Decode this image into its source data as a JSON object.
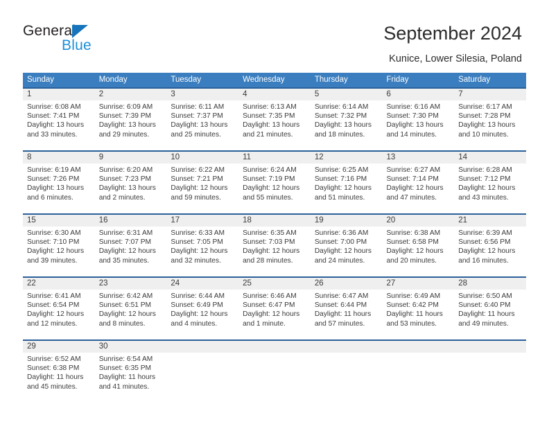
{
  "brand": {
    "word_one": "General",
    "word_two": "Blue",
    "triangle_color": "#1574bb",
    "blue_text_color": "#1a8fd8"
  },
  "header": {
    "title": "September 2024",
    "subtitle": "Kunice, Lower Silesia, Poland"
  },
  "colors": {
    "header_blue": "#3b7ebf",
    "row_divider": "#2a6099",
    "day_number_bar": "#efefef",
    "text": "#3a3a3a"
  },
  "weekdays": [
    "Sunday",
    "Monday",
    "Tuesday",
    "Wednesday",
    "Thursday",
    "Friday",
    "Saturday"
  ],
  "weeks": [
    [
      {
        "day": "1",
        "sunrise": "Sunrise: 6:08 AM",
        "sunset": "Sunset: 7:41 PM",
        "daylight_1": "Daylight: 13 hours",
        "daylight_2": "and 33 minutes."
      },
      {
        "day": "2",
        "sunrise": "Sunrise: 6:09 AM",
        "sunset": "Sunset: 7:39 PM",
        "daylight_1": "Daylight: 13 hours",
        "daylight_2": "and 29 minutes."
      },
      {
        "day": "3",
        "sunrise": "Sunrise: 6:11 AM",
        "sunset": "Sunset: 7:37 PM",
        "daylight_1": "Daylight: 13 hours",
        "daylight_2": "and 25 minutes."
      },
      {
        "day": "4",
        "sunrise": "Sunrise: 6:13 AM",
        "sunset": "Sunset: 7:35 PM",
        "daylight_1": "Daylight: 13 hours",
        "daylight_2": "and 21 minutes."
      },
      {
        "day": "5",
        "sunrise": "Sunrise: 6:14 AM",
        "sunset": "Sunset: 7:32 PM",
        "daylight_1": "Daylight: 13 hours",
        "daylight_2": "and 18 minutes."
      },
      {
        "day": "6",
        "sunrise": "Sunrise: 6:16 AM",
        "sunset": "Sunset: 7:30 PM",
        "daylight_1": "Daylight: 13 hours",
        "daylight_2": "and 14 minutes."
      },
      {
        "day": "7",
        "sunrise": "Sunrise: 6:17 AM",
        "sunset": "Sunset: 7:28 PM",
        "daylight_1": "Daylight: 13 hours",
        "daylight_2": "and 10 minutes."
      }
    ],
    [
      {
        "day": "8",
        "sunrise": "Sunrise: 6:19 AM",
        "sunset": "Sunset: 7:26 PM",
        "daylight_1": "Daylight: 13 hours",
        "daylight_2": "and 6 minutes."
      },
      {
        "day": "9",
        "sunrise": "Sunrise: 6:20 AM",
        "sunset": "Sunset: 7:23 PM",
        "daylight_1": "Daylight: 13 hours",
        "daylight_2": "and 2 minutes."
      },
      {
        "day": "10",
        "sunrise": "Sunrise: 6:22 AM",
        "sunset": "Sunset: 7:21 PM",
        "daylight_1": "Daylight: 12 hours",
        "daylight_2": "and 59 minutes."
      },
      {
        "day": "11",
        "sunrise": "Sunrise: 6:24 AM",
        "sunset": "Sunset: 7:19 PM",
        "daylight_1": "Daylight: 12 hours",
        "daylight_2": "and 55 minutes."
      },
      {
        "day": "12",
        "sunrise": "Sunrise: 6:25 AM",
        "sunset": "Sunset: 7:16 PM",
        "daylight_1": "Daylight: 12 hours",
        "daylight_2": "and 51 minutes."
      },
      {
        "day": "13",
        "sunrise": "Sunrise: 6:27 AM",
        "sunset": "Sunset: 7:14 PM",
        "daylight_1": "Daylight: 12 hours",
        "daylight_2": "and 47 minutes."
      },
      {
        "day": "14",
        "sunrise": "Sunrise: 6:28 AM",
        "sunset": "Sunset: 7:12 PM",
        "daylight_1": "Daylight: 12 hours",
        "daylight_2": "and 43 minutes."
      }
    ],
    [
      {
        "day": "15",
        "sunrise": "Sunrise: 6:30 AM",
        "sunset": "Sunset: 7:10 PM",
        "daylight_1": "Daylight: 12 hours",
        "daylight_2": "and 39 minutes."
      },
      {
        "day": "16",
        "sunrise": "Sunrise: 6:31 AM",
        "sunset": "Sunset: 7:07 PM",
        "daylight_1": "Daylight: 12 hours",
        "daylight_2": "and 35 minutes."
      },
      {
        "day": "17",
        "sunrise": "Sunrise: 6:33 AM",
        "sunset": "Sunset: 7:05 PM",
        "daylight_1": "Daylight: 12 hours",
        "daylight_2": "and 32 minutes."
      },
      {
        "day": "18",
        "sunrise": "Sunrise: 6:35 AM",
        "sunset": "Sunset: 7:03 PM",
        "daylight_1": "Daylight: 12 hours",
        "daylight_2": "and 28 minutes."
      },
      {
        "day": "19",
        "sunrise": "Sunrise: 6:36 AM",
        "sunset": "Sunset: 7:00 PM",
        "daylight_1": "Daylight: 12 hours",
        "daylight_2": "and 24 minutes."
      },
      {
        "day": "20",
        "sunrise": "Sunrise: 6:38 AM",
        "sunset": "Sunset: 6:58 PM",
        "daylight_1": "Daylight: 12 hours",
        "daylight_2": "and 20 minutes."
      },
      {
        "day": "21",
        "sunrise": "Sunrise: 6:39 AM",
        "sunset": "Sunset: 6:56 PM",
        "daylight_1": "Daylight: 12 hours",
        "daylight_2": "and 16 minutes."
      }
    ],
    [
      {
        "day": "22",
        "sunrise": "Sunrise: 6:41 AM",
        "sunset": "Sunset: 6:54 PM",
        "daylight_1": "Daylight: 12 hours",
        "daylight_2": "and 12 minutes."
      },
      {
        "day": "23",
        "sunrise": "Sunrise: 6:42 AM",
        "sunset": "Sunset: 6:51 PM",
        "daylight_1": "Daylight: 12 hours",
        "daylight_2": "and 8 minutes."
      },
      {
        "day": "24",
        "sunrise": "Sunrise: 6:44 AM",
        "sunset": "Sunset: 6:49 PM",
        "daylight_1": "Daylight: 12 hours",
        "daylight_2": "and 4 minutes."
      },
      {
        "day": "25",
        "sunrise": "Sunrise: 6:46 AM",
        "sunset": "Sunset: 6:47 PM",
        "daylight_1": "Daylight: 12 hours",
        "daylight_2": "and 1 minute."
      },
      {
        "day": "26",
        "sunrise": "Sunrise: 6:47 AM",
        "sunset": "Sunset: 6:44 PM",
        "daylight_1": "Daylight: 11 hours",
        "daylight_2": "and 57 minutes."
      },
      {
        "day": "27",
        "sunrise": "Sunrise: 6:49 AM",
        "sunset": "Sunset: 6:42 PM",
        "daylight_1": "Daylight: 11 hours",
        "daylight_2": "and 53 minutes."
      },
      {
        "day": "28",
        "sunrise": "Sunrise: 6:50 AM",
        "sunset": "Sunset: 6:40 PM",
        "daylight_1": "Daylight: 11 hours",
        "daylight_2": "and 49 minutes."
      }
    ],
    [
      {
        "day": "29",
        "sunrise": "Sunrise: 6:52 AM",
        "sunset": "Sunset: 6:38 PM",
        "daylight_1": "Daylight: 11 hours",
        "daylight_2": "and 45 minutes."
      },
      {
        "day": "30",
        "sunrise": "Sunrise: 6:54 AM",
        "sunset": "Sunset: 6:35 PM",
        "daylight_1": "Daylight: 11 hours",
        "daylight_2": "and 41 minutes."
      },
      {
        "day": "",
        "sunrise": "",
        "sunset": "",
        "daylight_1": "",
        "daylight_2": ""
      },
      {
        "day": "",
        "sunrise": "",
        "sunset": "",
        "daylight_1": "",
        "daylight_2": ""
      },
      {
        "day": "",
        "sunrise": "",
        "sunset": "",
        "daylight_1": "",
        "daylight_2": ""
      },
      {
        "day": "",
        "sunrise": "",
        "sunset": "",
        "daylight_1": "",
        "daylight_2": ""
      },
      {
        "day": "",
        "sunrise": "",
        "sunset": "",
        "daylight_1": "",
        "daylight_2": ""
      }
    ]
  ]
}
